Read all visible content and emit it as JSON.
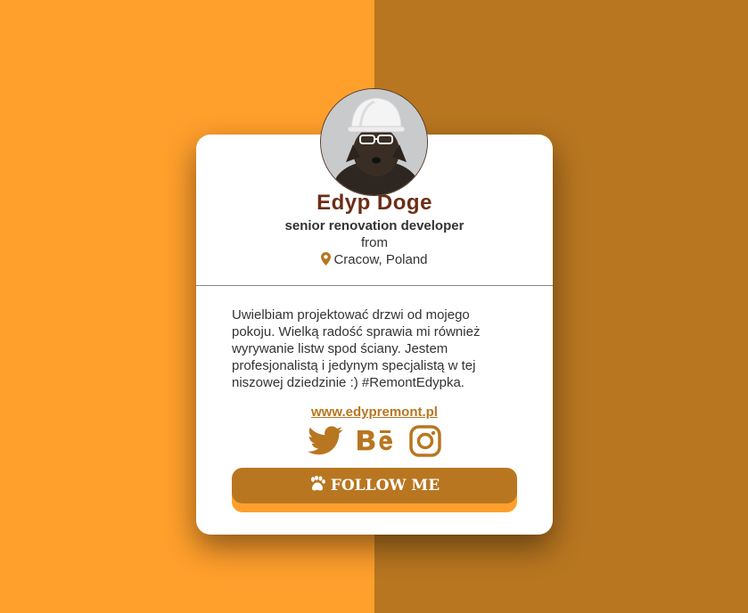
{
  "profile": {
    "name": "Edyp Doge",
    "role": "senior renovation developer",
    "from_label": "from",
    "location": "Cracow, Poland",
    "avatar_icon": "dog-with-hardhat-avatar"
  },
  "bio": "Uwielbiam projektować drzwi od mojego pokoju. Wielką radość sprawia mi również wyrywanie listw spod ściany. Jestem profesjonalistą i jedynym specjalistą w tej niszowej dziedzinie :) #RemontEdypka.",
  "website": "www.edypremont.pl",
  "socials": [
    {
      "icon": "twitter-icon"
    },
    {
      "icon": "behance-icon"
    },
    {
      "icon": "instagram-icon"
    }
  ],
  "follow_button": {
    "label": "FOLLOW ME",
    "icon": "paw-icon"
  },
  "colors": {
    "accent": "#b87620",
    "accent_light": "#ff9f2c",
    "name": "#6b2e16"
  }
}
